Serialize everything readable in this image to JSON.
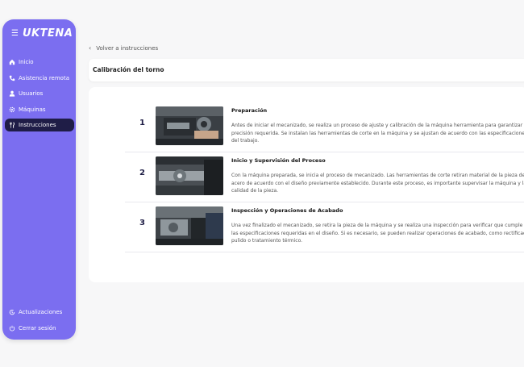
{
  "sidebar": {
    "brand": "UKTENA",
    "items": [
      {
        "label": "Inicio",
        "icon": "home-icon",
        "active": false
      },
      {
        "label": "Asistencia remota",
        "icon": "phone-icon",
        "active": false
      },
      {
        "label": "Usuarios",
        "icon": "user-icon",
        "active": false
      },
      {
        "label": "Máquinas",
        "icon": "gear-icon",
        "active": false
      },
      {
        "label": "Instrucciones",
        "icon": "utensils-icon",
        "active": true
      }
    ],
    "bottom": [
      {
        "label": "Actualizaciones",
        "icon": "update-icon"
      },
      {
        "label": "Cerrar sesión",
        "icon": "power-icon"
      }
    ]
  },
  "main": {
    "back_label": "Volver a instrucciones",
    "title": "Calibración del torno",
    "steps": [
      {
        "number": "1",
        "title": "Preparación",
        "description": "Antes de iniciar el mecanizado, se realiza un proceso de ajuste y calibración de la máquina herramienta para garantizar la precisión requerida. Se instalan las herramientas de corte en la máquina y se ajustan de acuerdo con las especificaciones del trabajo."
      },
      {
        "number": "2",
        "title": "Inicio y Supervisión del Proceso",
        "description": "Con la máquina preparada, se inicia el proceso de mecanizado. Las herramientas de corte retiran material de la pieza de acero de acuerdo con el diseño previamente establecido. Durante este proceso, es importante supervisar la máquina y la calidad de la pieza."
      },
      {
        "number": "3",
        "title": "Inspección y Operaciones de Acabado",
        "description": "Una vez finalizado el mecanizado, se retira la pieza de la máquina y se realiza una inspección para verificar que cumple con las especificaciones requeridas en el diseño. Si es necesario, se pueden realizar operaciones de acabado, como rectificado, pulido o tratamiento térmico."
      }
    ]
  },
  "colors": {
    "sidebar": "#7b6ef0",
    "active_item": "#1f1d47",
    "background": "#f7f7f8"
  }
}
